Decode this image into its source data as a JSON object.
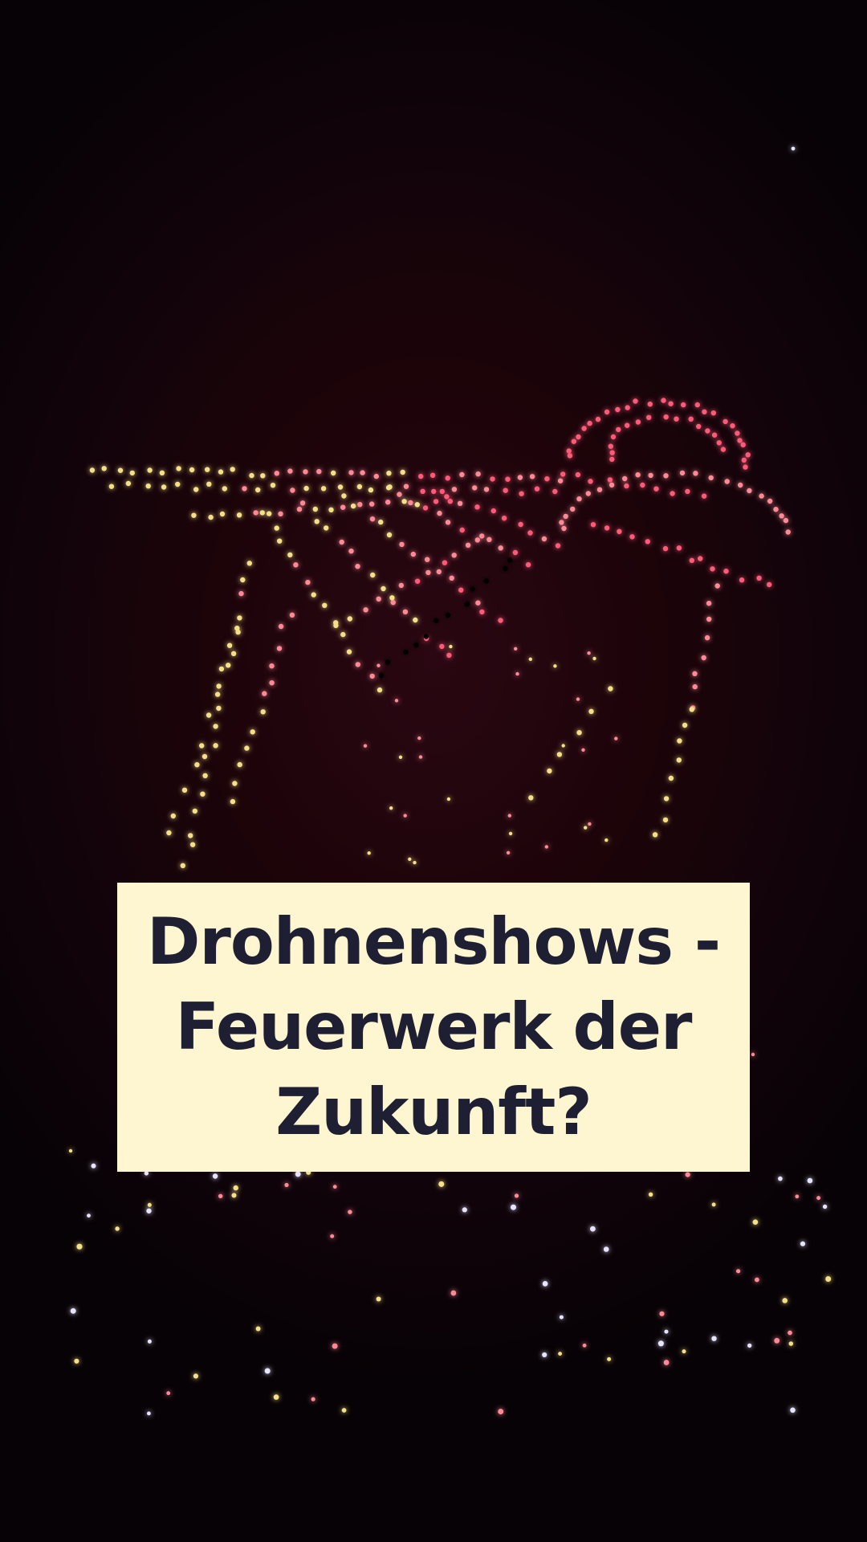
{
  "caption": {
    "title": "Drohnenshows -\nFeuerwerk der\nZukunft?"
  },
  "scene": {
    "subject": "drone-show-hummingbird",
    "colors": {
      "background": "#1a050b",
      "caption_background": "#fdf6d0",
      "caption_text": "#1f1f33",
      "drone_red": "#ff5a78",
      "drone_pink": "#ff8a96",
      "drone_yellow": "#f5e08a",
      "drone_white": "#e8e4ff"
    }
  }
}
